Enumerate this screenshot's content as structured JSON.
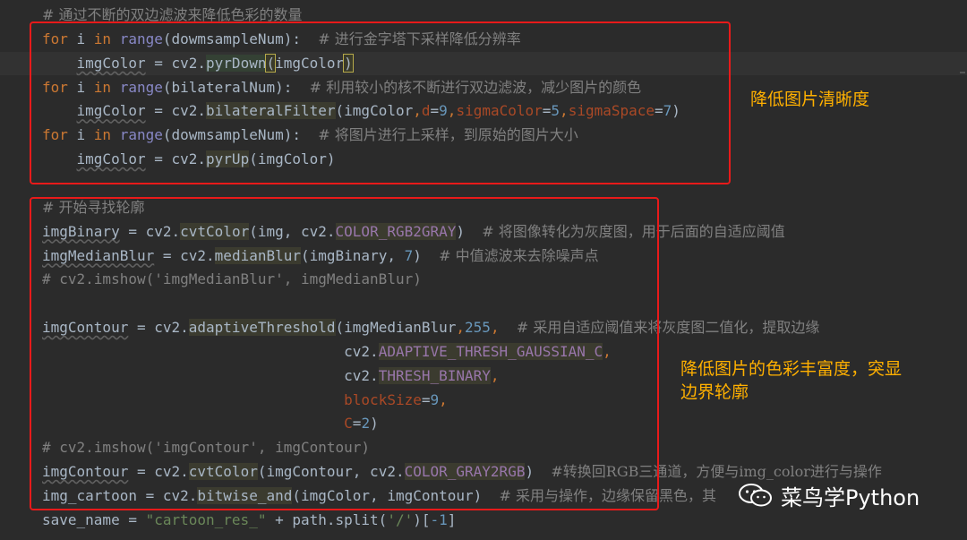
{
  "editor": {
    "lines": [
      [
        {
          "c": "cmtcn",
          "t": "# 通过不断的双边滤波来降低色彩的数量"
        }
      ],
      [
        {
          "c": "kw",
          "t": "for "
        },
        {
          "c": "p",
          "t": "i "
        },
        {
          "c": "kw",
          "t": "in "
        },
        {
          "c": "bi",
          "t": "range"
        },
        {
          "c": "p",
          "t": "(dowmsampleNum):  "
        },
        {
          "c": "cmtcn",
          "t": "# 进行金字塔下采样降低分辨率"
        }
      ],
      [
        {
          "c": "p",
          "t": "    "
        },
        {
          "c": "var",
          "t": "imgColor"
        },
        {
          "c": "p",
          "t": " = cv2."
        },
        {
          "c": "fnh",
          "t": "pyrDown"
        },
        {
          "c": "hl",
          "t": "("
        },
        {
          "c": "p",
          "t": "imgColor"
        },
        {
          "c": "hl",
          "t": ")"
        }
      ],
      [
        {
          "c": "kw",
          "t": "for "
        },
        {
          "c": "p",
          "t": "i "
        },
        {
          "c": "kw",
          "t": "in "
        },
        {
          "c": "bi",
          "t": "range"
        },
        {
          "c": "p",
          "t": "(bilateralNum):  "
        },
        {
          "c": "cmtcn",
          "t": "# 利用较小的核不断进行双边滤波，减少图片的颜色"
        }
      ],
      [
        {
          "c": "p",
          "t": "    "
        },
        {
          "c": "var",
          "t": "imgColor"
        },
        {
          "c": "p",
          "t": " = cv2."
        },
        {
          "c": "fn",
          "t": "bilateralFilter"
        },
        {
          "c": "p",
          "t": "(imgColor"
        },
        {
          "c": "kw",
          "t": ","
        },
        {
          "c": "kwarg",
          "t": "d"
        },
        {
          "c": "p",
          "t": "="
        },
        {
          "c": "num",
          "t": "9"
        },
        {
          "c": "kw",
          "t": ","
        },
        {
          "c": "kwarg",
          "t": "sigmaColor"
        },
        {
          "c": "p",
          "t": "="
        },
        {
          "c": "num",
          "t": "5"
        },
        {
          "c": "kw",
          "t": ","
        },
        {
          "c": "kwarg",
          "t": "sigmaSpace"
        },
        {
          "c": "p",
          "t": "="
        },
        {
          "c": "num",
          "t": "7"
        },
        {
          "c": "p",
          "t": ")"
        }
      ],
      [
        {
          "c": "kw",
          "t": "for "
        },
        {
          "c": "p",
          "t": "i "
        },
        {
          "c": "kw",
          "t": "in "
        },
        {
          "c": "bi",
          "t": "range"
        },
        {
          "c": "p",
          "t": "(dowmsampleNum):  "
        },
        {
          "c": "cmtcn",
          "t": "# 将图片进行上采样，到原始的图片大小"
        }
      ],
      [
        {
          "c": "p",
          "t": "    "
        },
        {
          "c": "var",
          "t": "imgColor"
        },
        {
          "c": "p",
          "t": " = cv2."
        },
        {
          "c": "fn",
          "t": "pyrUp"
        },
        {
          "c": "p",
          "t": "(imgColor)"
        }
      ],
      [],
      [
        {
          "c": "cmtcn",
          "t": "# 开始寻找轮廓"
        }
      ],
      [
        {
          "c": "var",
          "t": "imgBinary"
        },
        {
          "c": "p",
          "t": " = cv2."
        },
        {
          "c": "fn",
          "t": "cvtColor"
        },
        {
          "c": "p",
          "t": "(img, cv2."
        },
        {
          "c": "const",
          "t": "COLOR_RGB2GRAY"
        },
        {
          "c": "p",
          "t": ")  "
        },
        {
          "c": "cmtcn",
          "t": "# 将图像转化为灰度图，用于后面的自适应阈值"
        }
      ],
      [
        {
          "c": "var",
          "t": "imgMedianBlur"
        },
        {
          "c": "p",
          "t": " = cv2."
        },
        {
          "c": "fn",
          "t": "medianBlur"
        },
        {
          "c": "p",
          "t": "(imgBinary, "
        },
        {
          "c": "num",
          "t": "7"
        },
        {
          "c": "p",
          "t": ")  "
        },
        {
          "c": "cmtcn",
          "t": "# 中值滤波来去除噪声点"
        }
      ],
      [
        {
          "c": "cmt",
          "t": "# cv2.imshow('imgMedianBlur', imgMedianBlur)"
        }
      ],
      [],
      [
        {
          "c": "var",
          "t": "imgContour"
        },
        {
          "c": "p",
          "t": " = cv2."
        },
        {
          "c": "fn",
          "t": "adaptiveThreshold"
        },
        {
          "c": "p",
          "t": "(imgMedianBlur"
        },
        {
          "c": "kw",
          "t": ","
        },
        {
          "c": "num",
          "t": "255"
        },
        {
          "c": "kw",
          "t": ",  "
        },
        {
          "c": "cmtcn",
          "t": "# 采用自适应阈值来将灰度图二值化，提取边缘"
        }
      ],
      [
        {
          "c": "p",
          "t": "                                   cv2."
        },
        {
          "c": "const",
          "t": "ADAPTIVE_THRESH_GAUSSIAN_C"
        },
        {
          "c": "kw",
          "t": ","
        }
      ],
      [
        {
          "c": "p",
          "t": "                                   cv2."
        },
        {
          "c": "const",
          "t": "THRESH_BINARY"
        },
        {
          "c": "kw",
          "t": ","
        }
      ],
      [
        {
          "c": "p",
          "t": "                                   "
        },
        {
          "c": "kwarg",
          "t": "blockSize"
        },
        {
          "c": "p",
          "t": "="
        },
        {
          "c": "num",
          "t": "9"
        },
        {
          "c": "kw",
          "t": ","
        }
      ],
      [
        {
          "c": "p",
          "t": "                                   "
        },
        {
          "c": "kwarg",
          "t": "C"
        },
        {
          "c": "p",
          "t": "="
        },
        {
          "c": "num",
          "t": "2"
        },
        {
          "c": "p",
          "t": ")"
        }
      ],
      [
        {
          "c": "cmt",
          "t": "# cv2.imshow('imgContour', imgContour)"
        }
      ],
      [
        {
          "c": "var",
          "t": "imgContour"
        },
        {
          "c": "p",
          "t": " = cv2."
        },
        {
          "c": "fn",
          "t": "cvtColor"
        },
        {
          "c": "p",
          "t": "(imgContour, cv2."
        },
        {
          "c": "const",
          "t": "COLOR_GRAY2RGB"
        },
        {
          "c": "p",
          "t": ")  "
        },
        {
          "c": "cmtcn",
          "t": "#转换回RGB三通道，方便与img_color进行与操作"
        }
      ],
      [
        {
          "c": "p",
          "t": "img_cartoon = cv2."
        },
        {
          "c": "fn",
          "t": "bitwise_and"
        },
        {
          "c": "p",
          "t": "(imgColor, imgContour)  "
        },
        {
          "c": "cmtcn",
          "t": "# 采用与操作，边缘保留黑色，其"
        }
      ],
      [
        {
          "c": "p",
          "t": "save_name = "
        },
        {
          "c": "str",
          "t": "\"cartoon_res_\""
        },
        {
          "c": "p",
          "t": " + path.split("
        },
        {
          "c": "str",
          "t": "'/'"
        },
        {
          "c": "p",
          "t": ")["
        },
        {
          "c": "num",
          "t": "-1"
        },
        {
          "c": "p",
          "t": "]"
        }
      ]
    ]
  },
  "annotations": {
    "top_box_label": "降低图片清晰度",
    "bottom_box_label_line1": "降低图片的色彩丰富度，突显",
    "bottom_box_label_line2": "边界轮廓"
  },
  "watermark": {
    "text": "菜鸟学Python",
    "icon": "wechat-icon"
  },
  "colors": {
    "editor_bg": "#2b2b2b",
    "box_red": "#e81a1a",
    "annotation_orange": "#ffb000"
  }
}
